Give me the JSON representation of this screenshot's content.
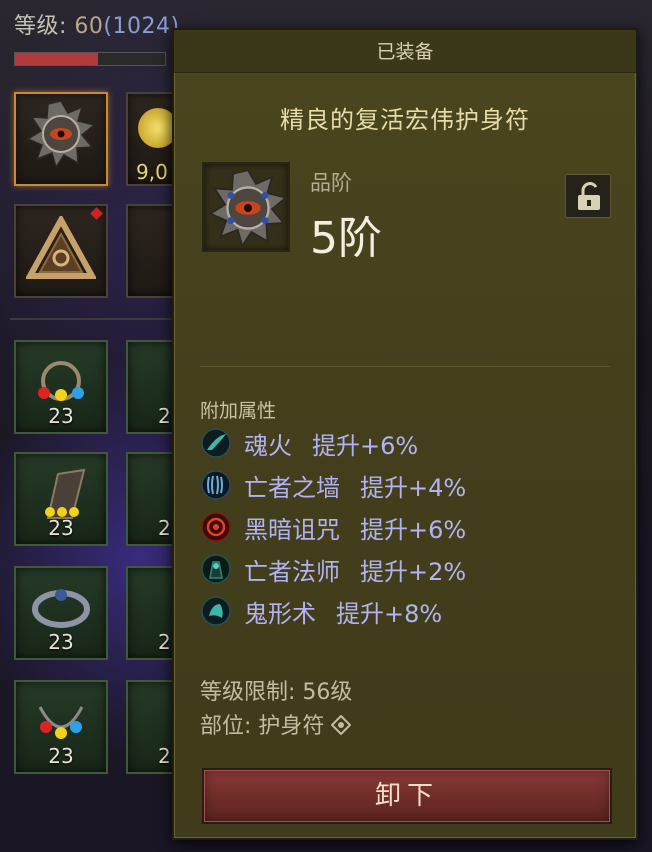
{
  "hud": {
    "level_label": "等级: ",
    "level_value": "60",
    "level_sub": "(1024)",
    "xp_fraction": 0.55,
    "gold_partial": "9,0"
  },
  "inventory": {
    "counts": [
      "23",
      "23",
      "23",
      "23"
    ],
    "partial_counts": [
      "2",
      "2",
      "2",
      "2"
    ]
  },
  "tooltip": {
    "header": "已装备",
    "item_name": "精良的复活宏伟护身符",
    "tier_label": "品阶",
    "tier_value": "5阶",
    "attributes_title": "附加属性",
    "attributes": [
      {
        "name": "魂火",
        "value": "提升+6%",
        "icon": "soulfire-icon",
        "color": "#3fb6a8"
      },
      {
        "name": "亡者之墙",
        "value": "提升+4%",
        "icon": "bone-wall-icon",
        "color": "#4a8fb0"
      },
      {
        "name": "黑暗诅咒",
        "value": "提升+6%",
        "icon": "dark-curse-icon",
        "color": "#c0302a"
      },
      {
        "name": "亡者法师",
        "value": "提升+2%",
        "icon": "skeletal-mage-icon",
        "color": "#2c8a78"
      },
      {
        "name": "鬼形术",
        "value": "提升+8%",
        "icon": "ghost-form-icon",
        "color": "#3fb6a8"
      }
    ],
    "requirement_label": "等级限制:",
    "requirement_value": "56级",
    "slot_label": "部位:",
    "slot_value": "护身符",
    "unequip_label": "卸下",
    "colors": {
      "panel": "#45411e",
      "attribute_text": "#b3b2f2",
      "title_text": "#e7dca8",
      "button": "#7a332e"
    }
  }
}
